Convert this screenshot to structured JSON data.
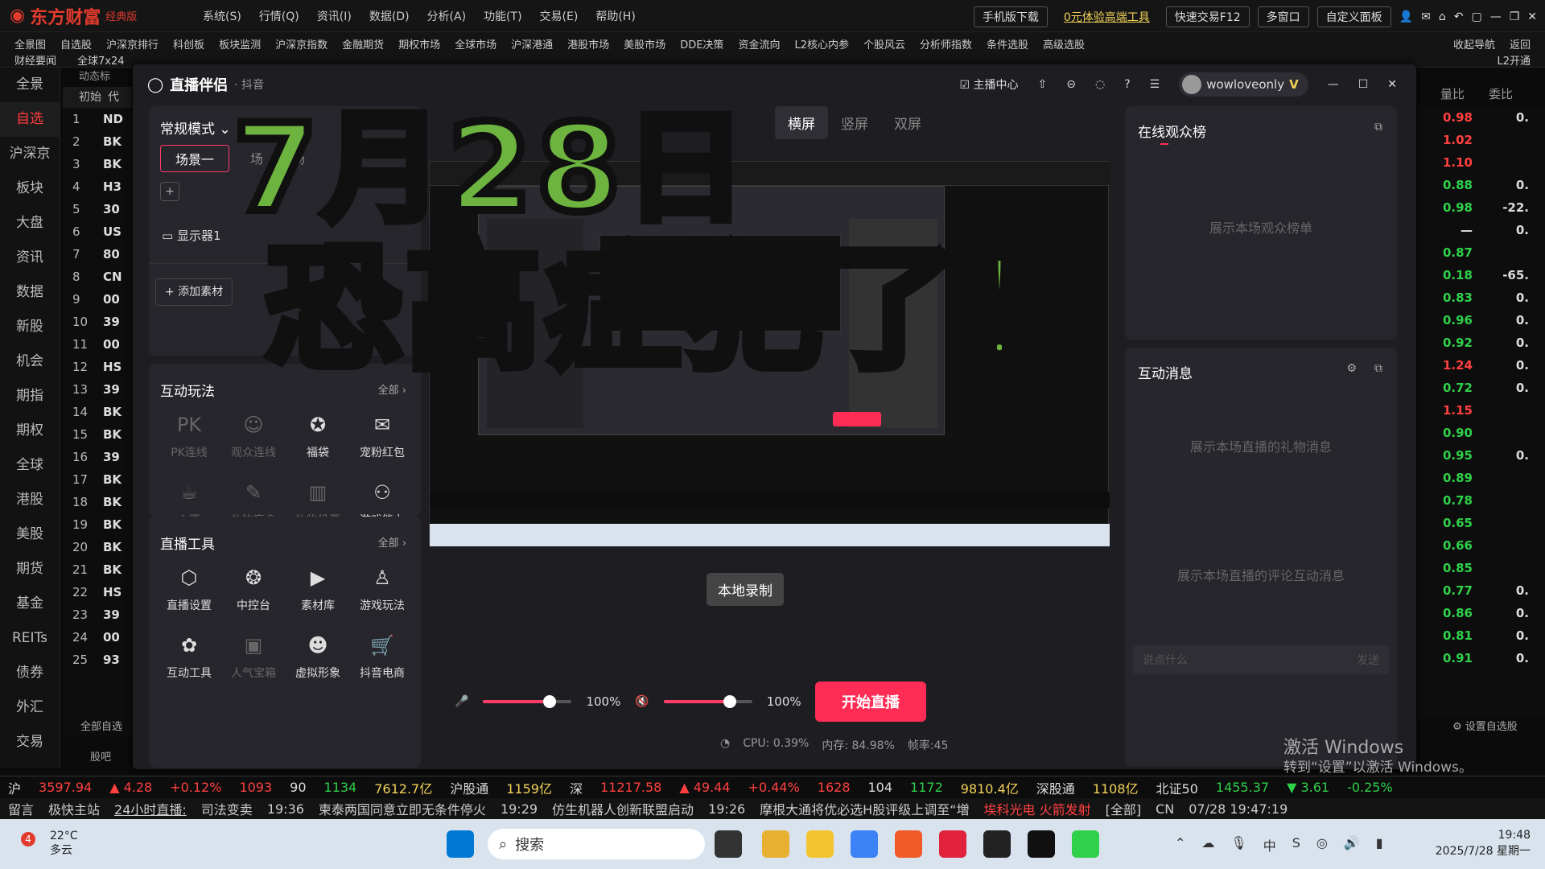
{
  "app": {
    "name": "东方财富",
    "edition": "经典版"
  },
  "topmenu": [
    "系统(S)",
    "行情(Q)",
    "资讯(I)",
    "数据(D)",
    "分析(A)",
    "功能(T)",
    "交易(E)",
    "帮助(H)"
  ],
  "topbuttons": {
    "mobile": "手机版下载",
    "promo": "0元体验高端工具",
    "quicktrade": "快速交易F12",
    "multiwin": "多窗口",
    "custom": "自定义面板"
  },
  "navrow1": [
    "全景图",
    "自选股",
    "沪深京排行",
    "科创板",
    "板块监测",
    "沪深京指数",
    "金融期货",
    "期权市场",
    "全球市场",
    "沪深港通",
    "港股市场",
    "美股市场",
    "DDE决策",
    "资金流向",
    "L2核心内参",
    "个股风云",
    "分析师指数",
    "条件选股",
    "高级选股"
  ],
  "navrow2": [
    "财经要闻",
    "全球7x24"
  ],
  "navright": [
    "收起导航",
    "返回"
  ],
  "navright2": "L2开通",
  "leftnav": [
    "全景",
    "自选",
    "沪深京",
    "板块",
    "大盘",
    "资讯",
    "数据",
    "新股",
    "机会",
    "期指",
    "期权",
    "全球",
    "港股",
    "美股",
    "期货",
    "基金",
    "REITs",
    "债券",
    "外汇",
    "交易"
  ],
  "stocklist": {
    "header": [
      "初始",
      "代"
    ],
    "tab": "动态标",
    "rows": [
      {
        "n": "1",
        "c": "ND"
      },
      {
        "n": "2",
        "c": "BK"
      },
      {
        "n": "3",
        "c": "BK"
      },
      {
        "n": "4",
        "c": "H3"
      },
      {
        "n": "5",
        "c": "30"
      },
      {
        "n": "6",
        "c": "US"
      },
      {
        "n": "7",
        "c": "80"
      },
      {
        "n": "8",
        "c": "CN"
      },
      {
        "n": "9",
        "c": "00"
      },
      {
        "n": "10",
        "c": "39"
      },
      {
        "n": "11",
        "c": "00"
      },
      {
        "n": "12",
        "c": "HS"
      },
      {
        "n": "13",
        "c": "39"
      },
      {
        "n": "14",
        "c": "BK"
      },
      {
        "n": "15",
        "c": "BK"
      },
      {
        "n": "16",
        "c": "39"
      },
      {
        "n": "17",
        "c": "BK"
      },
      {
        "n": "18",
        "c": "BK"
      },
      {
        "n": "19",
        "c": "BK"
      },
      {
        "n": "20",
        "c": "BK"
      },
      {
        "n": "21",
        "c": "BK"
      },
      {
        "n": "22",
        "c": "HS"
      },
      {
        "n": "23",
        "c": "39"
      },
      {
        "n": "24",
        "c": "00"
      },
      {
        "n": "25",
        "c": "93"
      }
    ],
    "footer1": "全部自选",
    "footer2": "股吧"
  },
  "rightcols": {
    "headers": [
      "量比",
      "委比"
    ],
    "rows": [
      {
        "v": "0.98",
        "w": "0.",
        "cv": "red"
      },
      {
        "v": "1.02",
        "w": "",
        "cv": "red"
      },
      {
        "v": "1.10",
        "w": "",
        "cv": "red"
      },
      {
        "v": "0.88",
        "w": "0.",
        "cv": "green"
      },
      {
        "v": "0.98",
        "w": "-22.",
        "cv": "green"
      },
      {
        "v": "—",
        "w": "0.",
        "cv": "wh"
      },
      {
        "v": "0.87",
        "w": "",
        "cv": "green"
      },
      {
        "v": "0.18",
        "w": "-65.",
        "cv": "green"
      },
      {
        "v": "0.83",
        "w": "0.",
        "cv": "green"
      },
      {
        "v": "0.96",
        "w": "0.",
        "cv": "green"
      },
      {
        "v": "0.92",
        "w": "0.",
        "cv": "green"
      },
      {
        "v": "1.24",
        "w": "0.",
        "cv": "red"
      },
      {
        "v": "0.72",
        "w": "0.",
        "cv": "green"
      },
      {
        "v": "1.15",
        "w": "",
        "cv": "red"
      },
      {
        "v": "0.90",
        "w": "",
        "cv": "green"
      },
      {
        "v": "0.95",
        "w": "0.",
        "cv": "green"
      },
      {
        "v": "0.89",
        "w": "",
        "cv": "green"
      },
      {
        "v": "0.78",
        "w": "",
        "cv": "green"
      },
      {
        "v": "0.65",
        "w": "",
        "cv": "green"
      },
      {
        "v": "0.66",
        "w": "",
        "cv": "green"
      },
      {
        "v": "0.85",
        "w": "",
        "cv": "green"
      },
      {
        "v": "0.77",
        "w": "0.",
        "cv": "green"
      },
      {
        "v": "0.86",
        "w": "0.",
        "cv": "green"
      },
      {
        "v": "0.81",
        "w": "0.",
        "cv": "green"
      },
      {
        "v": "0.91",
        "w": "0.",
        "cv": "green"
      }
    ],
    "footer": "设置自选股"
  },
  "window": {
    "title": "直播伴侣",
    "platform": "· 抖音",
    "anchor_center": "主播中心",
    "username": "wowloveonly",
    "mode": "常规模式",
    "scenes": [
      "场景一",
      "场",
      "场"
    ],
    "source": "显示器1",
    "add_source": "添加素材",
    "tabs": [
      "横屏",
      "竖屏",
      "双屏"
    ],
    "interact_title": "互动玩法",
    "all": "全部",
    "interact_items": [
      {
        "label": "PK连线",
        "icon": "pk-icon",
        "glyph": "PK",
        "dim": true
      },
      {
        "label": "观众连线",
        "icon": "audience-link-icon",
        "glyph": "☺",
        "dim": true
      },
      {
        "label": "福袋",
        "icon": "lucky-bag-icon",
        "glyph": "✪",
        "dim": false
      },
      {
        "label": "宠粉红包",
        "icon": "red-packet-icon",
        "glyph": "✉",
        "dim": false
      },
      {
        "label": "心愿",
        "icon": "wish-icon",
        "glyph": "☕",
        "dim": true
      },
      {
        "label": "礼物盲盒",
        "icon": "gift-box-icon",
        "glyph": "✎",
        "dim": true
      },
      {
        "label": "礼物投票",
        "icon": "gift-vote-icon",
        "glyph": "▥",
        "dim": true
      },
      {
        "label": "游戏能力",
        "icon": "gamepad-icon",
        "glyph": "⚇",
        "dim": false
      }
    ],
    "tools_title": "直播工具",
    "tools_items": [
      {
        "label": "直播设置",
        "icon": "live-settings-icon",
        "glyph": "⬡",
        "dim": false
      },
      {
        "label": "中控台",
        "icon": "console-icon",
        "glyph": "❂",
        "dim": false
      },
      {
        "label": "素材库",
        "icon": "material-library-icon",
        "glyph": "▶",
        "dim": false
      },
      {
        "label": "游戏玩法",
        "icon": "game-play-icon",
        "glyph": "♙",
        "dim": false
      },
      {
        "label": "互动工具",
        "icon": "interact-tool-icon",
        "glyph": "✿",
        "dim": false
      },
      {
        "label": "人气宝箱",
        "icon": "treasure-icon",
        "glyph": "▣",
        "dim": true
      },
      {
        "label": "虚拟形象",
        "icon": "avatar-icon",
        "glyph": "☻",
        "dim": false
      },
      {
        "label": "抖音电商",
        "icon": "cart-icon",
        "glyph": "🛒",
        "dim": false
      }
    ],
    "mic_volume": "100%",
    "speaker_volume": "100%",
    "mic_level": 0.75,
    "speaker_level": 0.75,
    "tooltip": "本地录制",
    "start_live": "开始直播",
    "cpu": "CPU: 0.39%",
    "mem": "内存: 84.98%",
    "fps": "帧率:45",
    "audience_title": "在线观众榜",
    "audience_hint": "展示本场观众榜单",
    "msg_title": "互动消息",
    "gift_hint": "展示本场直播的礼物消息",
    "comment_hint": "展示本场直播的评论互动消息",
    "input_placeholder": "说点什么",
    "send": "发送"
  },
  "overlay": {
    "line1": "7月28日",
    "line2": "恐高症犯了！"
  },
  "ticker": {
    "sh_label": "沪",
    "sh_price": "3597.94",
    "sh_chg": "▲ 4.28",
    "sh_pct": "+0.12%",
    "sh_up": "1093",
    "sh_flat": "90",
    "sh_down": "1134",
    "sh_amt": "7612.7亿",
    "hgt_label": "沪股通",
    "hgt_amt": "1159亿",
    "sz_label": "深",
    "sz_price": "11217.58",
    "sz_chg": "▲ 49.44",
    "sz_pct": "+0.44%",
    "sz_up": "1628",
    "sz_flat": "104",
    "sz_down": "1172",
    "sz_amt": "9810.4亿",
    "sgt_label": "深股通",
    "sgt_amt": "1108亿",
    "bz_label": "北证50",
    "bz_price": "1455.37",
    "bz_chg": "▼ 3.61",
    "bz_pct": "-0.25%"
  },
  "news": {
    "items": [
      "留言",
      "极快主站",
      "24小时直播:",
      "司法变卖"
    ],
    "n1_time": "19:36",
    "n1": "柬泰两国同意立即无条件停火",
    "n2_time": "19:29",
    "n2": "仿生机器人创新联盟启动",
    "n3_time": "19:26",
    "n3": "摩根大通将优必选H股评级上调至“増",
    "hot": "埃科光电 火箭发射",
    "scope": "[全部]",
    "market": "CN",
    "datetime": "07/28 19:47:19"
  },
  "winmark": {
    "line1": "激活 Windows",
    "line2": "转到“设置”以激活 Windows。"
  },
  "taskbar": {
    "temp": "22°C",
    "weather": "多云",
    "badge": "4",
    "search": "搜索",
    "time": "19:48",
    "date": "2025/7/28 星期一"
  }
}
